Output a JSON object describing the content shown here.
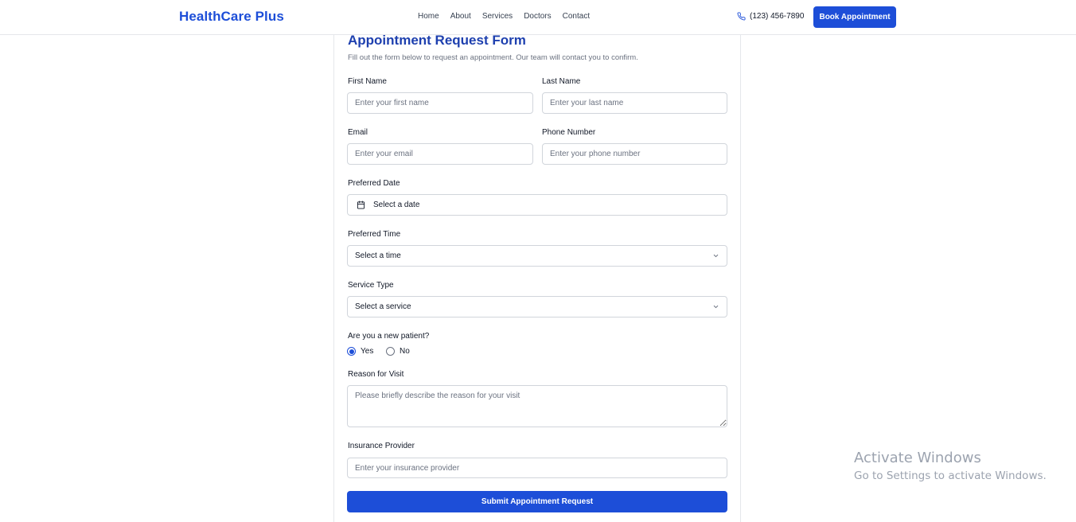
{
  "header": {
    "brand": "HealthCare Plus",
    "nav": [
      "Home",
      "About",
      "Services",
      "Doctors",
      "Contact"
    ],
    "phone": "(123) 456-7890",
    "book_label": "Book Appointment"
  },
  "form": {
    "title": "Appointment Request Form",
    "subtitle": "Fill out the form below to request an appointment. Our team will contact you to confirm.",
    "first_name": {
      "label": "First Name",
      "placeholder": "Enter your first name"
    },
    "last_name": {
      "label": "Last Name",
      "placeholder": "Enter your last name"
    },
    "email": {
      "label": "Email",
      "placeholder": "Enter your email"
    },
    "phone": {
      "label": "Phone Number",
      "placeholder": "Enter your phone number"
    },
    "date": {
      "label": "Preferred Date",
      "value": "Select a date"
    },
    "time": {
      "label": "Preferred Time",
      "value": "Select a time"
    },
    "service": {
      "label": "Service Type",
      "value": "Select a service"
    },
    "new_patient": {
      "label": "Are you a new patient?",
      "yes": "Yes",
      "no": "No",
      "selected": "Yes"
    },
    "reason": {
      "label": "Reason for Visit",
      "placeholder": "Please briefly describe the reason for your visit"
    },
    "insurance": {
      "label": "Insurance Provider",
      "placeholder": "Enter your insurance provider"
    },
    "submit_label": "Submit Appointment Request"
  },
  "watermark": {
    "title": "Activate Windows",
    "subtitle": "Go to Settings to activate Windows."
  },
  "colors": {
    "accent": "#1d4ed8",
    "title": "#1e40af",
    "border": "#d1d5db"
  }
}
